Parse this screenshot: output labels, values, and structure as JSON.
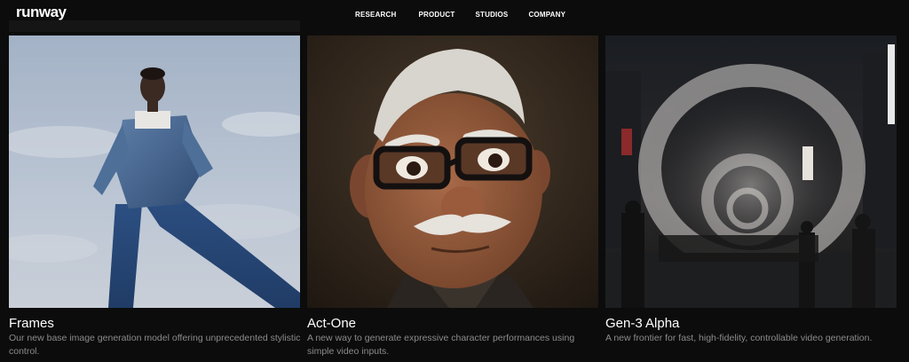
{
  "header": {
    "logo": "runway",
    "nav": [
      "RESEARCH",
      "PRODUCT",
      "STUDIOS",
      "COMPANY"
    ]
  },
  "cards": [
    {
      "title": "Frames",
      "description": "Our new base image generation model offering unprecedented stylistic control."
    },
    {
      "title": "Act-One",
      "description": "A new way to generate expressive character performances using simple video inputs."
    },
    {
      "title": "Gen-3 Alpha",
      "description": "A new frontier for fast, high-fidelity, controllable video generation."
    }
  ],
  "colors": {
    "background": "#0c0c0c",
    "text": "#ffffff",
    "muted_text": "#8b8b8b"
  }
}
